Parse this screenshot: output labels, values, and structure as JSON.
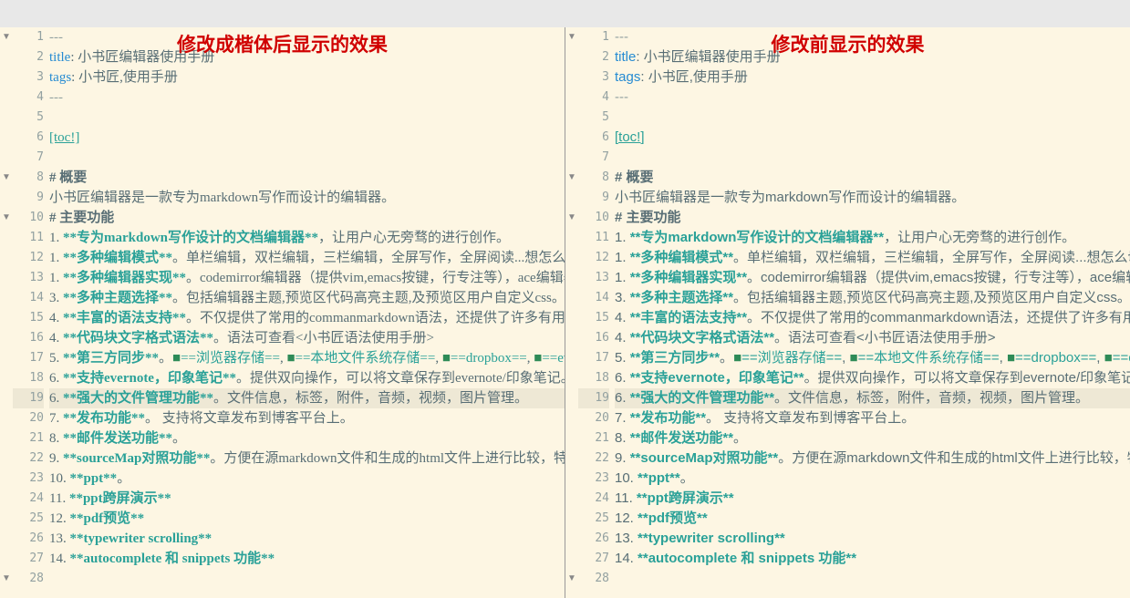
{
  "left_title": "修改成楷体后显示的效果",
  "right_title": "修改前显示的效果",
  "lines": [
    {
      "num": 1,
      "fold": true,
      "seg": [
        {
          "cls": "tok-fm",
          "text": "---"
        }
      ]
    },
    {
      "num": 2,
      "seg": [
        {
          "cls": "tok-key",
          "text": "title"
        },
        {
          "cls": "tok-text",
          "text": ": 小书匠编辑器使用手册"
        }
      ]
    },
    {
      "num": 3,
      "seg": [
        {
          "cls": "tok-key",
          "text": "tags"
        },
        {
          "cls": "tok-text",
          "text": ": 小书匠,使用手册"
        }
      ]
    },
    {
      "num": 4,
      "seg": [
        {
          "cls": "tok-fm",
          "text": "---"
        }
      ]
    },
    {
      "num": 5,
      "seg": []
    },
    {
      "num": 6,
      "seg": [
        {
          "cls": "tok-link",
          "text": "[toc!]"
        }
      ]
    },
    {
      "num": 7,
      "seg": []
    },
    {
      "num": 8,
      "fold": true,
      "seg": [
        {
          "cls": "tok-head",
          "text": "# 概要"
        }
      ]
    },
    {
      "num": 9,
      "seg": [
        {
          "cls": "tok-text",
          "text": "小书匠编辑器是一款专为markdown写作而设计的编辑器。"
        }
      ]
    },
    {
      "num": 10,
      "fold": true,
      "seg": [
        {
          "cls": "tok-head",
          "text": "# 主要功能"
        }
      ]
    },
    {
      "num": 11,
      "seg": [
        {
          "cls": "tok-text",
          "text": "1. "
        },
        {
          "cls": "tok-bold",
          "text": "**专为markdown写作设计的文档编辑器**"
        },
        {
          "cls": "tok-text",
          "text": "，让用户心无旁骛的进行创作。"
        }
      ]
    },
    {
      "num": 12,
      "seg": [
        {
          "cls": "tok-text",
          "text": "1. "
        },
        {
          "cls": "tok-bold",
          "text": "**多种编辑模式**"
        },
        {
          "cls": "tok-text",
          "text": "。单栏编辑，双栏编辑，三栏编辑，全屏写作，全屏阅读...想怎么切换就怎么切换。"
        }
      ]
    },
    {
      "num": 13,
      "seg": [
        {
          "cls": "tok-text",
          "text": "1. "
        },
        {
          "cls": "tok-bold",
          "text": "**多种编辑器实现**"
        },
        {
          "cls": "tok-text",
          "text": "。codemirror编辑器（提供vim,emacs按键，行专注等），ace编辑器。"
        }
      ]
    },
    {
      "num": 14,
      "seg": [
        {
          "cls": "tok-text",
          "text": "3. "
        },
        {
          "cls": "tok-bold",
          "text": "**多种主题选择**"
        },
        {
          "cls": "tok-text",
          "text": "。包括编辑器主题,预览区代码高亮主题,及预览区用户自定义css。"
        }
      ]
    },
    {
      "num": 15,
      "seg": [
        {
          "cls": "tok-text",
          "text": "4. "
        },
        {
          "cls": "tok-bold",
          "text": "**丰富的语法支持**"
        },
        {
          "cls": "tok-text",
          "text": "。不仅提供了常用的commanmarkdown语法，还提供了许多有用的扩展语法。"
        }
      ]
    },
    {
      "num": 16,
      "seg": [
        {
          "cls": "tok-text",
          "text": "4. "
        },
        {
          "cls": "tok-bold",
          "text": "**代码块文字格式语法**"
        },
        {
          "cls": "tok-text",
          "text": "。语法可查看<小书匠语法使用手册>"
        }
      ]
    },
    {
      "num": 17,
      "seg": [
        {
          "cls": "tok-text",
          "text": "5. "
        },
        {
          "cls": "tok-bold",
          "text": "**第三方同步**"
        },
        {
          "cls": "tok-text",
          "text": "。"
        },
        {
          "cls": "tok-green",
          "text": "■"
        },
        {
          "cls": "tok-teal",
          "text": "==浏览器存储=="
        },
        {
          "cls": "tok-text",
          "text": ", "
        },
        {
          "cls": "tok-green",
          "text": "■"
        },
        {
          "cls": "tok-teal",
          "text": "==本地文件系统存储=="
        },
        {
          "cls": "tok-text",
          "text": ", "
        },
        {
          "cls": "tok-green",
          "text": "■"
        },
        {
          "cls": "tok-teal",
          "text": "==dropbox=="
        },
        {
          "cls": "tok-text",
          "text": ", "
        },
        {
          "cls": "tok-green",
          "text": "■"
        },
        {
          "cls": "tok-teal",
          "text": "==evernote=="
        }
      ]
    },
    {
      "num": 18,
      "seg": [
        {
          "cls": "tok-text",
          "text": "6. "
        },
        {
          "cls": "tok-bold",
          "text": "**支持evernote，印象笔记**"
        },
        {
          "cls": "tok-text",
          "text": "。提供双向操作，可以将文章保存到evernote/印象笔记。"
        }
      ]
    },
    {
      "num": 19,
      "active": true,
      "seg": [
        {
          "cls": "tok-text",
          "text": "6. "
        },
        {
          "cls": "tok-bold",
          "text": "**强大的文件管理功能**"
        },
        {
          "cls": "tok-text",
          "text": "。文件信息，标签，附件，音频，视频，图片管理。"
        }
      ]
    },
    {
      "num": 20,
      "seg": [
        {
          "cls": "tok-text",
          "text": "7. "
        },
        {
          "cls": "tok-bold",
          "text": "**发布功能**"
        },
        {
          "cls": "tok-text",
          "text": "。 支持将文章发布到博客平台上。"
        }
      ]
    },
    {
      "num": 21,
      "seg": [
        {
          "cls": "tok-text",
          "text": "8. "
        },
        {
          "cls": "tok-bold",
          "text": "**邮件发送功能**"
        },
        {
          "cls": "tok-text",
          "text": "。"
        }
      ]
    },
    {
      "num": 22,
      "seg": [
        {
          "cls": "tok-text",
          "text": "9. "
        },
        {
          "cls": "tok-bold",
          "text": "**sourceMap对照功能**"
        },
        {
          "cls": "tok-text",
          "text": "。方便在源markdown文件和生成的html文件上进行比较，特别适合译者。"
        }
      ]
    },
    {
      "num": 23,
      "seg": [
        {
          "cls": "tok-text",
          "text": "10. "
        },
        {
          "cls": "tok-bold",
          "text": "**ppt**"
        },
        {
          "cls": "tok-text",
          "text": "。"
        }
      ]
    },
    {
      "num": 24,
      "seg": [
        {
          "cls": "tok-text",
          "text": "11. "
        },
        {
          "cls": "tok-bold",
          "text": "**ppt跨屏演示**"
        }
      ]
    },
    {
      "num": 25,
      "seg": [
        {
          "cls": "tok-text",
          "text": "12. "
        },
        {
          "cls": "tok-bold",
          "text": "**pdf预览**"
        }
      ]
    },
    {
      "num": 26,
      "seg": [
        {
          "cls": "tok-text",
          "text": "13. "
        },
        {
          "cls": "tok-bold",
          "text": "**typewriter scrolling**"
        }
      ]
    },
    {
      "num": 27,
      "seg": [
        {
          "cls": "tok-text",
          "text": "14. "
        },
        {
          "cls": "tok-bold",
          "text": "**autocomplete 和 snippets 功能**"
        }
      ]
    },
    {
      "num": 28,
      "fold": true,
      "seg": []
    }
  ]
}
